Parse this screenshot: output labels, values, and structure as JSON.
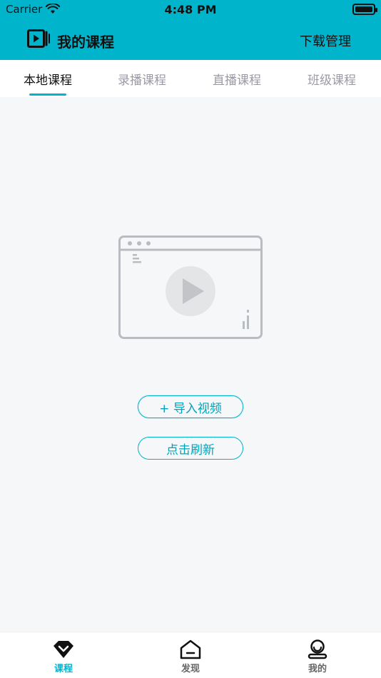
{
  "status_bar": {
    "carrier": "Carrier",
    "time": "4:48 PM"
  },
  "nav": {
    "title": "我的课程",
    "action": "下载管理"
  },
  "tabs": [
    {
      "label": "本地课程",
      "active": true
    },
    {
      "label": "录播课程",
      "active": false
    },
    {
      "label": "直播课程",
      "active": false
    },
    {
      "label": "班级课程",
      "active": false
    }
  ],
  "buttons": {
    "import": "+ 导入视频",
    "refresh": "点击刷新"
  },
  "bottom_tabs": [
    {
      "label": "课程",
      "icon": "course-icon",
      "active": true
    },
    {
      "label": "发现",
      "icon": "discover-icon",
      "active": false
    },
    {
      "label": "我的",
      "icon": "profile-icon",
      "active": false
    }
  ],
  "colors": {
    "accent": "#00b4cc",
    "inactive_tab": "#9a9aa6",
    "background": "#f6f7f9"
  }
}
